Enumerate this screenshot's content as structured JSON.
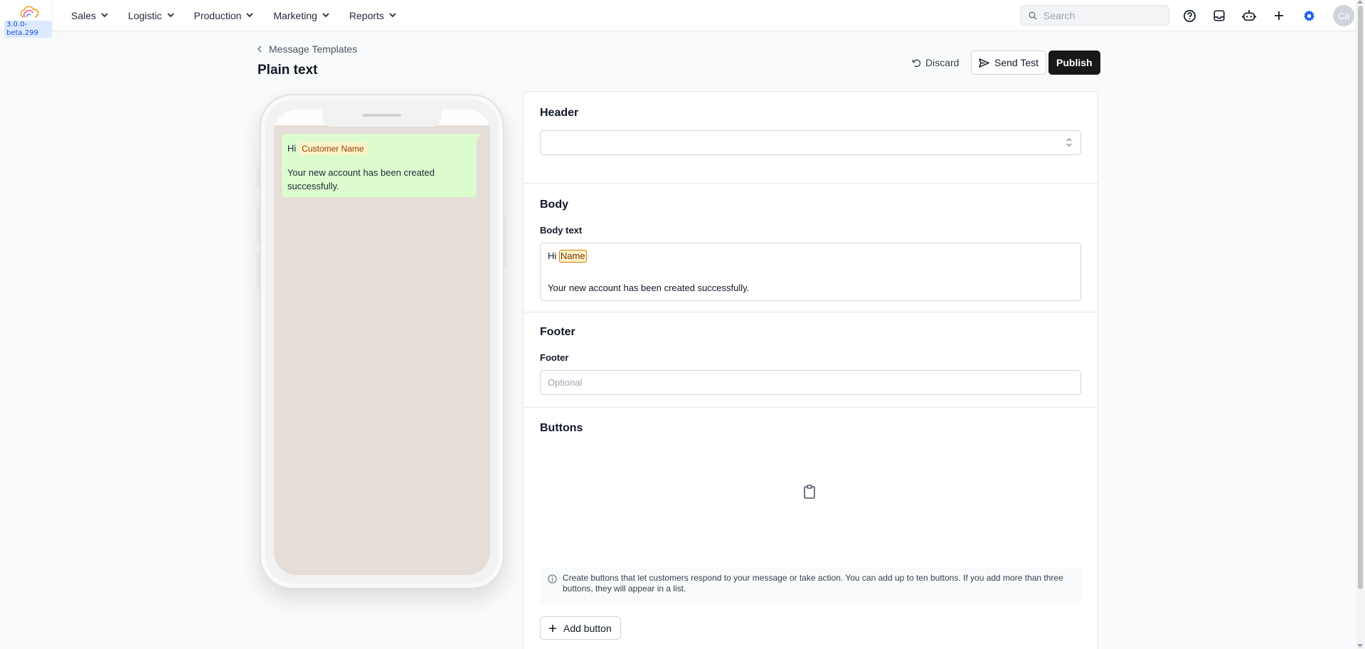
{
  "app": {
    "version": "3.0.0-beta.299"
  },
  "nav": [
    {
      "label": "Sales"
    },
    {
      "label": "Logistic"
    },
    {
      "label": "Production"
    },
    {
      "label": "Marketing"
    },
    {
      "label": "Reports"
    }
  ],
  "search": {
    "placeholder": "Search"
  },
  "user": {
    "initials": "Ca"
  },
  "icons": {
    "help": "help-circle-icon",
    "inbox": "inbox-icon",
    "bot": "bot-icon",
    "add": "plus-icon",
    "settings": "gear-icon",
    "accent": "#2563eb"
  },
  "page": {
    "breadcrumb": "Message Templates",
    "title": "Plain text",
    "actions": {
      "discard": "Discard",
      "send_test": "Send Test",
      "publish": "Publish"
    }
  },
  "preview": {
    "greeting": "Hi",
    "variable": "Customer Name",
    "body": "Your new account has been created successfully."
  },
  "editor": {
    "header": {
      "title": "Header",
      "value": ""
    },
    "body": {
      "title": "Body",
      "label": "Body text",
      "greeting": "Hi",
      "variable": "Name",
      "text": "Your new account has been created successfully."
    },
    "footer": {
      "title": "Footer",
      "label": "Footer",
      "placeholder": "Optional"
    },
    "buttons": {
      "title": "Buttons",
      "info": "Create buttons that let customers respond to your message or take action. You can add up to ten buttons. If you add more than three buttons, they will appear in a list.",
      "add_label": "Add button"
    }
  }
}
